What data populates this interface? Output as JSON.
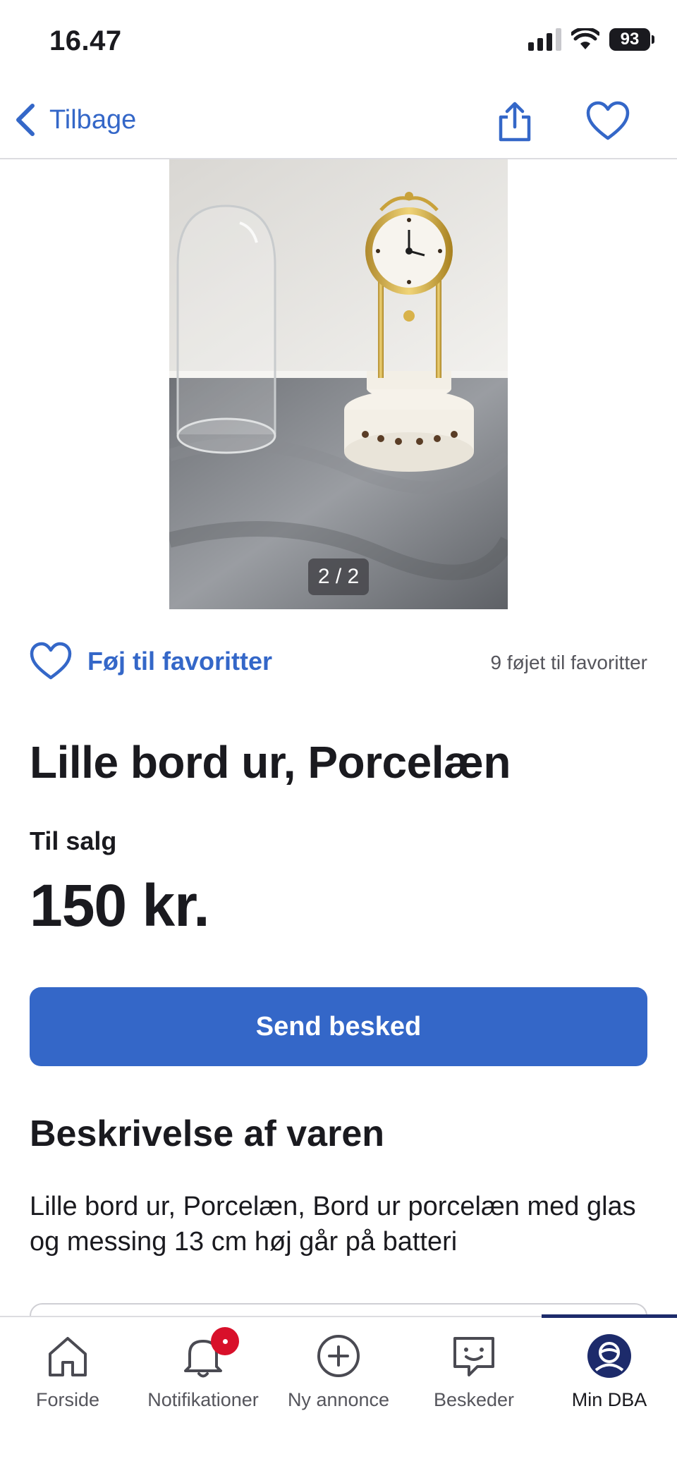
{
  "status_bar": {
    "time": "16.47",
    "battery": "93"
  },
  "nav": {
    "back_label": "Tilbage"
  },
  "gallery": {
    "counter": "2 / 2"
  },
  "favorites": {
    "add_label": "Føj til favoritter",
    "count_text": "9 føjet til favoritter"
  },
  "listing": {
    "title": "Lille bord ur, Porcelæn",
    "sale_type": "Til salg",
    "price": "150 kr."
  },
  "actions": {
    "send_message": "Send besked"
  },
  "description": {
    "heading": "Beskrivelse af varen",
    "text": "Lille bord ur, Porcelæn, Bord ur porcelæn med glas og messing 13 cm høj går på batteri"
  },
  "tabs": [
    {
      "label": "Forside",
      "icon": "home-icon"
    },
    {
      "label": "Notifikationer",
      "icon": "bell-icon"
    },
    {
      "label": "Ny annonce",
      "icon": "plus-circle-icon"
    },
    {
      "label": "Beskeder",
      "icon": "chat-icon"
    },
    {
      "label": "Min DBA",
      "icon": "profile-icon"
    }
  ],
  "colors": {
    "accent": "#3467c8",
    "badge": "#d8102a",
    "active_tab": "#1d2b6b"
  }
}
